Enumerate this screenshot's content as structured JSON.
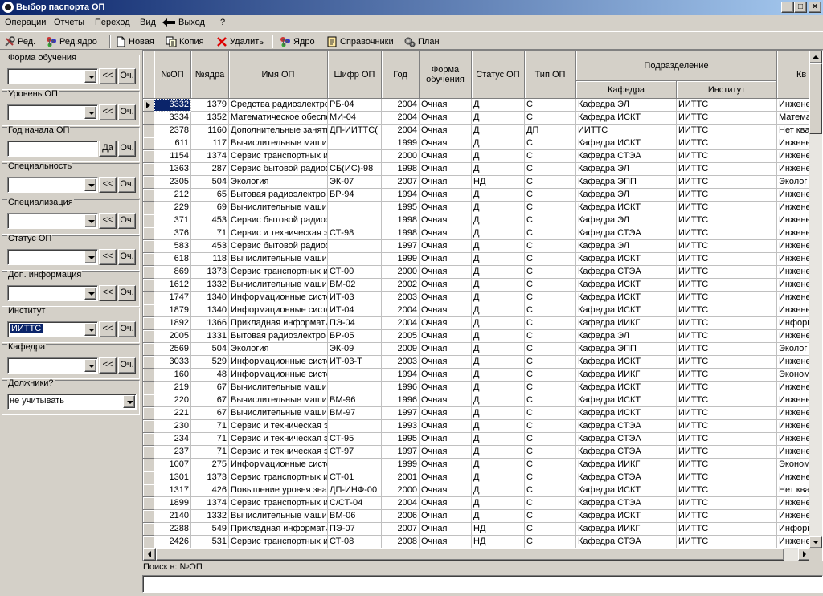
{
  "window": {
    "title": "Выбор паспорта ОП"
  },
  "titlebar_buttons": {
    "minimize": "_",
    "maximize": "□",
    "close": "×"
  },
  "menu": [
    "Операции",
    "Отчеты",
    "Переход",
    "Вид",
    "Выход",
    "?"
  ],
  "toolbar": [
    {
      "label": "Ред.",
      "icon": "tools-icon"
    },
    {
      "label": "Ред.ядро",
      "icon": "molecule-edit-icon"
    },
    {
      "label": "Новая",
      "icon": "new-document-icon"
    },
    {
      "label": "Копия",
      "icon": "copy-icon"
    },
    {
      "label": "Удалить",
      "icon": "delete-x-icon"
    },
    {
      "label": "Ядро",
      "icon": "molecule-icon"
    },
    {
      "label": "Справочники",
      "icon": "reference-book-icon"
    },
    {
      "label": "План",
      "icon": "plan-gears-icon"
    }
  ],
  "filters": [
    {
      "label": "Форма обучения",
      "type": "combo",
      "value": "",
      "b1": "<<",
      "b2": "Оч."
    },
    {
      "label": "Уровень ОП",
      "type": "combo",
      "value": "",
      "b1": "<<",
      "b2": "Оч."
    },
    {
      "label": "Год начала ОП",
      "type": "text",
      "value": "",
      "b1": "Да",
      "b2": "Оч."
    },
    {
      "label": "Специальность",
      "type": "combo",
      "value": "",
      "b1": "<<",
      "b2": "Оч."
    },
    {
      "label": "Специализация",
      "type": "combo",
      "value": "",
      "b1": "<<",
      "b2": "Оч."
    },
    {
      "label": "Статус ОП",
      "type": "combo",
      "value": "",
      "b1": "<<",
      "b2": "Оч."
    },
    {
      "label": "Доп. информация",
      "type": "combo",
      "value": "",
      "b1": "<<",
      "b2": "Оч."
    },
    {
      "label": "Институт",
      "type": "combo",
      "value": "ИИТТС",
      "selected": true,
      "b1": "<<",
      "b2": "Оч."
    },
    {
      "label": "Кафедра",
      "type": "combo",
      "value": "",
      "b1": "<<",
      "b2": "Оч."
    },
    {
      "label": "Должники?",
      "type": "wide",
      "value": "не учитывать"
    }
  ],
  "grid": {
    "headers": {
      "nop": "№ОП",
      "nyadra": "№ядра",
      "name": "Имя ОП",
      "shifr": "Шифр ОП",
      "god": "Год",
      "forma": "Форма обучения",
      "status": "Статус ОП",
      "tip": "Тип ОП",
      "podrazd": "Подразделение",
      "kafedra": "Кафедра",
      "institut": "Институт",
      "kval": "Кв"
    },
    "rows": [
      [
        "3332",
        "1379",
        "Средства радиоэлектро",
        "РБ-04",
        "2004",
        "Очная",
        "Д",
        "С",
        "Кафедра ЭЛ",
        "ИИТТС",
        "Инжене"
      ],
      [
        "3334",
        "1352",
        "Математическое обеспе",
        "МИ-04",
        "2004",
        "Очная",
        "Д",
        "С",
        "Кафедра ИСКТ",
        "ИИТТС",
        "Матема"
      ],
      [
        "2378",
        "1160",
        "Дополнительные заняти",
        "ДП-ИИТТС(",
        "2004",
        "Очная",
        "Д",
        "ДП",
        "ИИТТС",
        "ИИТТС",
        "Нет ква"
      ],
      [
        "611",
        "117",
        "Вычислительные машин",
        "",
        "1999",
        "Очная",
        "Д",
        "С",
        "Кафедра ИСКТ",
        "ИИТТС",
        "Инжене"
      ],
      [
        "1154",
        "1374",
        "Сервис транспортных и",
        "",
        "2000",
        "Очная",
        "Д",
        "С",
        "Кафедра СТЭА",
        "ИИТТС",
        "Инжене"
      ],
      [
        "1363",
        "287",
        "Сервис бытовой радиоэ",
        "СБ(ИС)-98",
        "1998",
        "Очная",
        "Д",
        "С",
        "Кафедра ЭЛ",
        "ИИТТС",
        "Инжене"
      ],
      [
        "2305",
        "504",
        "Экология",
        "ЭК-07",
        "2007",
        "Очная",
        "НД",
        "С",
        "Кафедра ЭПП",
        "ИИТТС",
        "Эколог"
      ],
      [
        "212",
        "65",
        "Бытовая радиоэлектро",
        "БР-94",
        "1994",
        "Очная",
        "Д",
        "С",
        "Кафедра ЭЛ",
        "ИИТТС",
        "Инжене"
      ],
      [
        "229",
        "69",
        "Вычислительные машин",
        "",
        "1995",
        "Очная",
        "Д",
        "С",
        "Кафедра ИСКТ",
        "ИИТТС",
        "Инжене"
      ],
      [
        "371",
        "453",
        "Сервис бытовой радиоэ",
        "",
        "1998",
        "Очная",
        "Д",
        "С",
        "Кафедра ЭЛ",
        "ИИТТС",
        "Инжене"
      ],
      [
        "376",
        "71",
        "Сервис и техническая э",
        "СТ-98",
        "1998",
        "Очная",
        "Д",
        "С",
        "Кафедра СТЭА",
        "ИИТТС",
        "Инжене"
      ],
      [
        "583",
        "453",
        "Сервис бытовой радиоэ",
        "",
        "1997",
        "Очная",
        "Д",
        "С",
        "Кафедра ЭЛ",
        "ИИТТС",
        "Инжене"
      ],
      [
        "618",
        "118",
        "Вычислительные машин",
        "",
        "1999",
        "Очная",
        "Д",
        "С",
        "Кафедра ИСКТ",
        "ИИТТС",
        "Инжене"
      ],
      [
        "869",
        "1373",
        "Сервис транспортных и",
        "СТ-00",
        "2000",
        "Очная",
        "Д",
        "С",
        "Кафедра СТЭА",
        "ИИТТС",
        "Инжене"
      ],
      [
        "1612",
        "1332",
        "Вычислительные машин",
        "ВМ-02",
        "2002",
        "Очная",
        "Д",
        "С",
        "Кафедра ИСКТ",
        "ИИТТС",
        "Инжене"
      ],
      [
        "1747",
        "1340",
        "Информационные систе",
        "ИТ-03",
        "2003",
        "Очная",
        "Д",
        "С",
        "Кафедра ИСКТ",
        "ИИТТС",
        "Инжене"
      ],
      [
        "1879",
        "1340",
        "Информационные систе",
        "ИТ-04",
        "2004",
        "Очная",
        "Д",
        "С",
        "Кафедра ИСКТ",
        "ИИТТС",
        "Инжене"
      ],
      [
        "1892",
        "1366",
        "Прикладная информати",
        "ПЭ-04",
        "2004",
        "Очная",
        "Д",
        "С",
        "Кафедра ИИКГ",
        "ИИТТС",
        "Инфорн"
      ],
      [
        "2005",
        "1331",
        "Бытовая радиоэлектро",
        "БР-05",
        "2005",
        "Очная",
        "Д",
        "С",
        "Кафедра ЭЛ",
        "ИИТТС",
        "Инжене"
      ],
      [
        "2569",
        "504",
        "Экология",
        "ЭК-09",
        "2009",
        "Очная",
        "Д",
        "С",
        "Кафедра ЭПП",
        "ИИТТС",
        "Эколог"
      ],
      [
        "3033",
        "529",
        "Информационные систе",
        "ИТ-03-Т",
        "2003",
        "Очная",
        "Д",
        "С",
        "Кафедра ИСКТ",
        "ИИТТС",
        "Инжене"
      ],
      [
        "160",
        "48",
        "Информационные систе",
        "",
        "1994",
        "Очная",
        "Д",
        "С",
        "Кафедра ИИКГ",
        "ИИТТС",
        "Эконом"
      ],
      [
        "219",
        "67",
        "Вычислительные машин",
        "",
        "1996",
        "Очная",
        "Д",
        "С",
        "Кафедра ИСКТ",
        "ИИТТС",
        "Инжене"
      ],
      [
        "220",
        "67",
        "Вычислительные машин",
        "ВМ-96",
        "1996",
        "Очная",
        "Д",
        "С",
        "Кафедра ИСКТ",
        "ИИТТС",
        "Инжене"
      ],
      [
        "221",
        "67",
        "Вычислительные машин",
        "ВМ-97",
        "1997",
        "Очная",
        "Д",
        "С",
        "Кафедра ИСКТ",
        "ИИТТС",
        "Инжене"
      ],
      [
        "230",
        "71",
        "Сервис и техническая э",
        "",
        "1993",
        "Очная",
        "Д",
        "С",
        "Кафедра СТЭА",
        "ИИТТС",
        "Инжене"
      ],
      [
        "234",
        "71",
        "Сервис и техническая э",
        "СТ-95",
        "1995",
        "Очная",
        "Д",
        "С",
        "Кафедра СТЭА",
        "ИИТТС",
        "Инжене"
      ],
      [
        "237",
        "71",
        "Сервис и техническая э",
        "СТ-97",
        "1997",
        "Очная",
        "Д",
        "С",
        "Кафедра СТЭА",
        "ИИТТС",
        "Инжене"
      ],
      [
        "1007",
        "275",
        "Информационные систе",
        "",
        "1999",
        "Очная",
        "Д",
        "С",
        "Кафедра ИИКГ",
        "ИИТТС",
        "Эконом"
      ],
      [
        "1301",
        "1373",
        "Сервис транспортных и",
        "СТ-01",
        "2001",
        "Очная",
        "Д",
        "С",
        "Кафедра СТЭА",
        "ИИТТС",
        "Инжене"
      ],
      [
        "1317",
        "426",
        "Повышение уровня знан",
        "ДП-ИНФ-00",
        "2000",
        "Очная",
        "Д",
        "С",
        "Кафедра ИСКТ",
        "ИИТТС",
        "Нет ква"
      ],
      [
        "1899",
        "1374",
        "Сервис транспортных и",
        "С/СТ-04",
        "2004",
        "Очная",
        "Д",
        "С",
        "Кафедра СТЭА",
        "ИИТТС",
        "Инжене"
      ],
      [
        "2140",
        "1332",
        "Вычислительные машин",
        "ВМ-06",
        "2006",
        "Очная",
        "Д",
        "С",
        "Кафедра ИСКТ",
        "ИИТТС",
        "Инжене"
      ],
      [
        "2288",
        "549",
        "Прикладная информати",
        "ПЭ-07",
        "2007",
        "Очная",
        "НД",
        "С",
        "Кафедра ИИКГ",
        "ИИТТС",
        "Инфорн"
      ],
      [
        "2426",
        "531",
        "Сервис транспортных и",
        "СТ-08",
        "2008",
        "Очная",
        "НД",
        "С",
        "Кафедра СТЭА",
        "ИИТТС",
        "Инжене"
      ]
    ]
  },
  "search": {
    "label": "Поиск в: №ОП",
    "value": ""
  },
  "colors": {
    "titlebar": "#0a246a",
    "face": "#d4d0c8",
    "selection": "#0a246a"
  }
}
